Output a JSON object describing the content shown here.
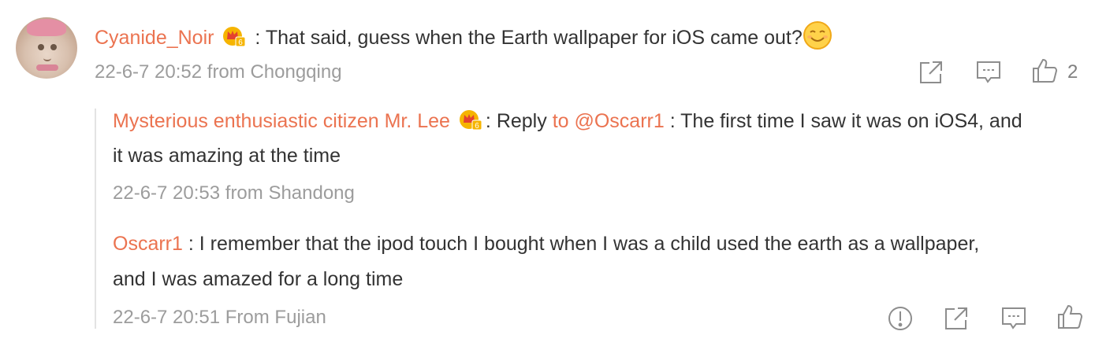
{
  "comment": {
    "username": "Cyanide_Noir",
    "separator": " : ",
    "text": "That said, guess when the Earth wallpaper for iOS came out?",
    "meta": "22-6-7 20:52 from Chongqing",
    "like_count": "2",
    "icons": {
      "vip": "vip-crown-icon",
      "emoji": "smile-emoji-icon"
    }
  },
  "replies": [
    {
      "username": "Mysterious enthusiastic citizen Mr. Lee",
      "reply_word": ": Reply ",
      "reply_to": "to @Oscarr1",
      "text_line1": " : The first time I saw it was on iOS4, and",
      "text_line2": "it was amazing at the time",
      "meta": "22-6-7 20:53 from Shandong"
    },
    {
      "username": "Oscarr1",
      "text_line1": " : I remember that the ipod touch I bought when I was a child used the earth as a wallpaper,",
      "text_line2": "and I was amazed for a long time",
      "meta": "22-6-7 20:51 From Fujian"
    }
  ],
  "colors": {
    "username": "#eb7350",
    "text": "#333333",
    "meta": "#9c9c9c",
    "icon": "#8d8d8d"
  }
}
